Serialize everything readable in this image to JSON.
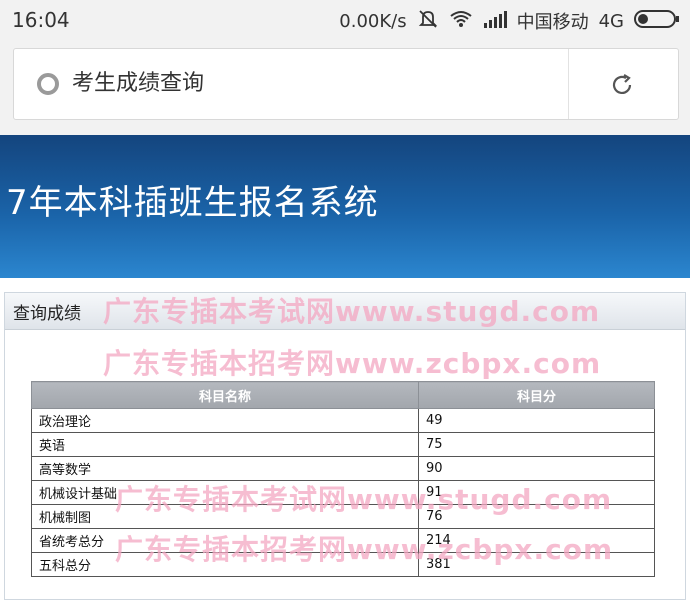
{
  "status_bar": {
    "time": "16:04",
    "network_speed": "0.00K/s",
    "carrier": "中国移动",
    "network_type": "4G"
  },
  "browser": {
    "page_title": "考生成绩查询"
  },
  "banner": {
    "title": "7年本科插班生报名系统"
  },
  "panel": {
    "title": "查询成绩"
  },
  "watermarks": [
    "广东专插本考试网www.stugd.com",
    "广东专插本招考网www.zcbpx.com"
  ],
  "table": {
    "headers": [
      "科目名称",
      "科目分"
    ],
    "rows": [
      {
        "subject": "政治理论",
        "score": "49"
      },
      {
        "subject": "英语",
        "score": "75"
      },
      {
        "subject": "高等数学",
        "score": "90"
      },
      {
        "subject": "机械设计基础",
        "score": "91"
      },
      {
        "subject": "机械制图",
        "score": "76"
      },
      {
        "subject": "省统考总分",
        "score": "214"
      },
      {
        "subject": "五科总分",
        "score": "381"
      }
    ]
  },
  "colors": {
    "banner_top": "#14457e",
    "banner_bottom": "#2b86cf",
    "watermark": "#f4a7c2",
    "table_header": "#a8acb2"
  },
  "icons": [
    "mute-icon",
    "wifi-icon",
    "signal-icon",
    "battery-icon",
    "globe-icon",
    "reload-icon"
  ]
}
